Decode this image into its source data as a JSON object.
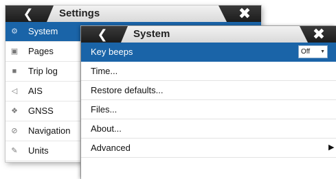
{
  "settings_panel": {
    "title": "Settings",
    "back_icon": "chevron-left-icon",
    "close_icon": "close-icon",
    "items": [
      {
        "label": "System",
        "icon": "gear-icon",
        "selected": true
      },
      {
        "label": "Pages",
        "icon": "pages-icon"
      },
      {
        "label": "Trip log",
        "icon": "trip-log-icon"
      },
      {
        "label": "AIS",
        "icon": "ais-icon"
      },
      {
        "label": "GNSS",
        "icon": "satellite-icon"
      },
      {
        "label": "Navigation",
        "icon": "compass-icon"
      },
      {
        "label": "Units",
        "icon": "pencil-icon"
      }
    ]
  },
  "system_panel": {
    "title": "System",
    "back_icon": "chevron-left-icon",
    "close_icon": "close-icon",
    "items": [
      {
        "label": "Key beeps",
        "selected": true,
        "value": "Off"
      },
      {
        "label": "Time..."
      },
      {
        "label": "Restore defaults..."
      },
      {
        "label": "Files..."
      },
      {
        "label": "About..."
      },
      {
        "label": "Advanced",
        "has_submenu": true
      }
    ]
  },
  "colors": {
    "selection": "#1a64a8",
    "header_dark": "#1c1c1c"
  }
}
